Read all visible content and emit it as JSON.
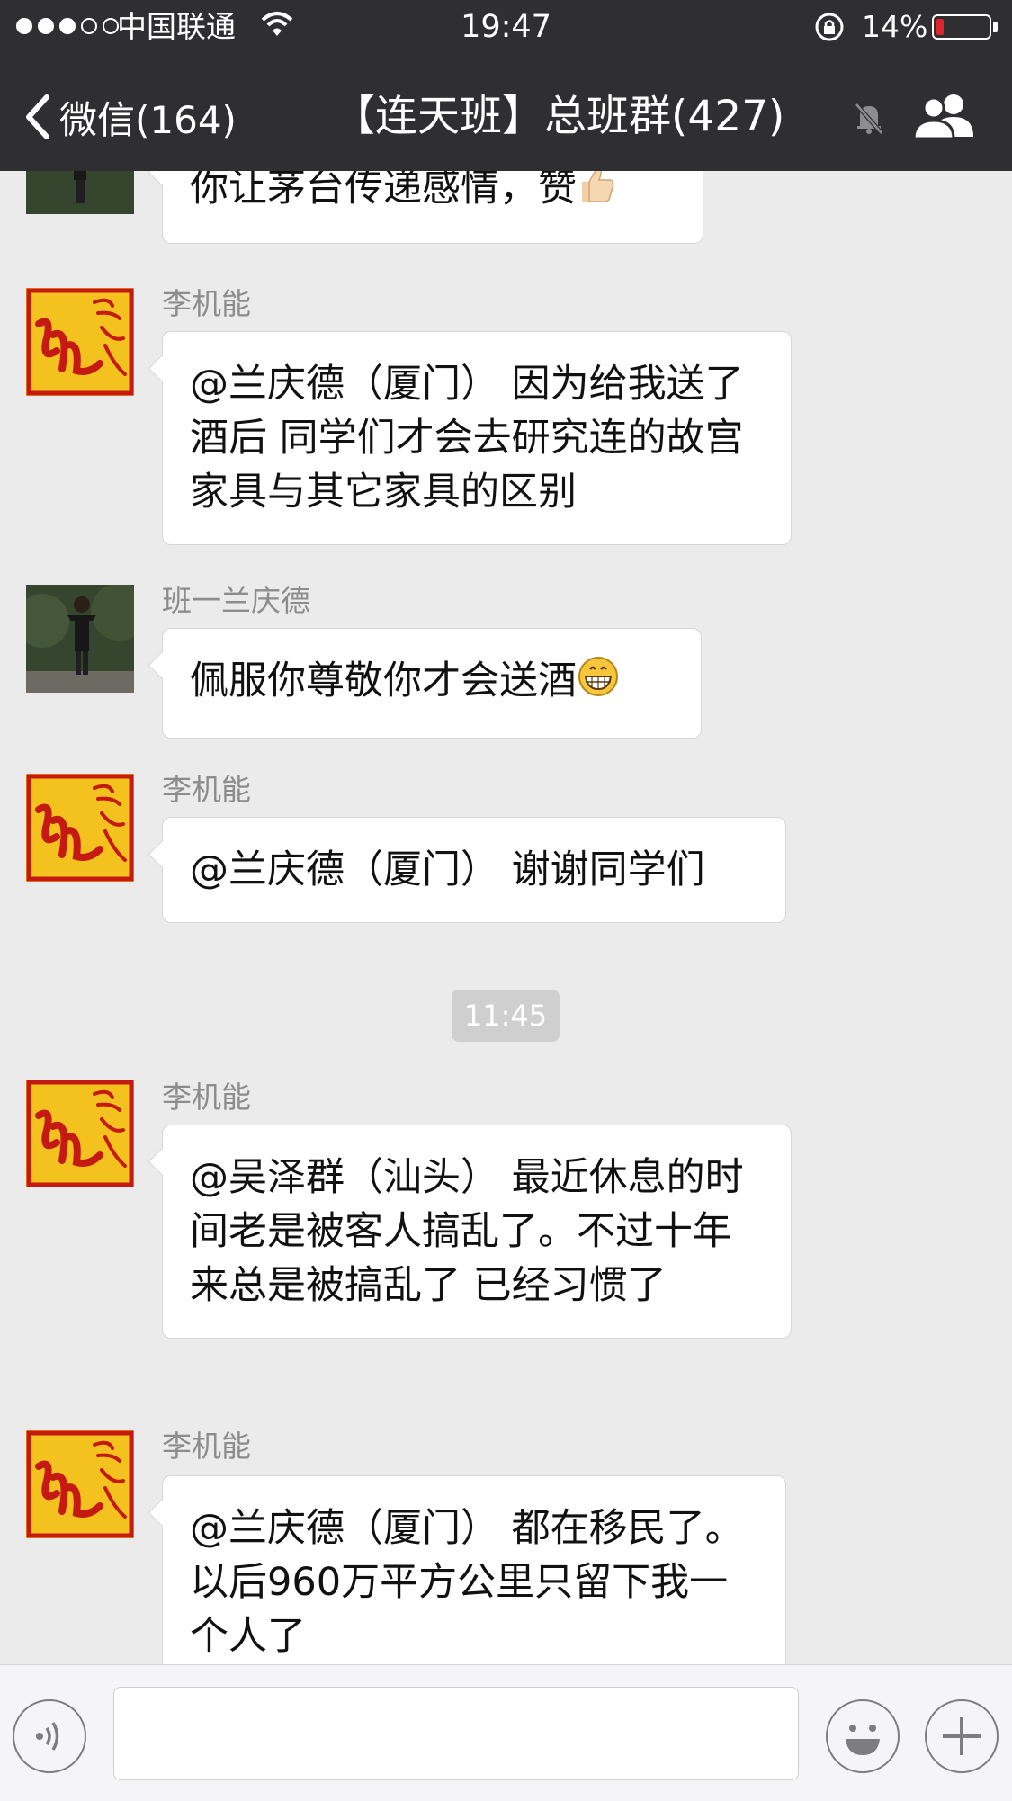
{
  "status_bar": {
    "carrier": "中国联通",
    "time": "19:47",
    "battery_text": "14%",
    "battery_level": 0.14,
    "battery_color": "#e0242b",
    "signal_bars_filled": 3,
    "signal_bars_total": 5
  },
  "nav": {
    "back_label": "微信(164)",
    "title": "【连天班】总班群(427)",
    "icons": [
      "chevron-left-icon",
      "mute-bell-icon",
      "group-members-icon"
    ]
  },
  "messages": [
    {
      "sender": "",
      "avatar": "photo",
      "text": "你让茅台传递感情，赞",
      "emoji": "thumbs-up-emoji"
    },
    {
      "sender": "李机能",
      "avatar": "red-calligraphy",
      "text": "@兰庆德（厦门） 因为给我送了酒后 同学们才会去研究连的故宫家具与其它家具的区别",
      "emoji": ""
    },
    {
      "sender": "班一兰庆德",
      "avatar": "photo",
      "text": "佩服你尊敬你才会送酒",
      "emoji": "grin-emoji"
    },
    {
      "sender": "李机能",
      "avatar": "red-calligraphy",
      "text": "@兰庆德（厦门） 谢谢同学们",
      "emoji": ""
    },
    {
      "sender": "李机能",
      "avatar": "red-calligraphy",
      "text": "@吴泽群（汕头） 最近休息的时间老是被客人搞乱了。不过十年来总是被搞乱了 已经习惯了",
      "emoji": ""
    },
    {
      "sender": "李机能",
      "avatar": "red-calligraphy",
      "text": "@兰庆德（厦门） 都在移民了。以后960万平方公里只留下我一个人了",
      "emoji": ""
    }
  ],
  "timestamp": "11:45",
  "input_bar": {
    "icons": [
      "voice-icon",
      "emoji-icon",
      "plus-icon"
    ],
    "input_value": ""
  },
  "colors": {
    "nav_background": "#2f2f31",
    "chat_background": "#ebebeb",
    "bubble_background": "#ffffff",
    "sender_text": "#8c8c8c",
    "avatar_gold": "#f4c21e",
    "avatar_red": "#c41a12"
  }
}
